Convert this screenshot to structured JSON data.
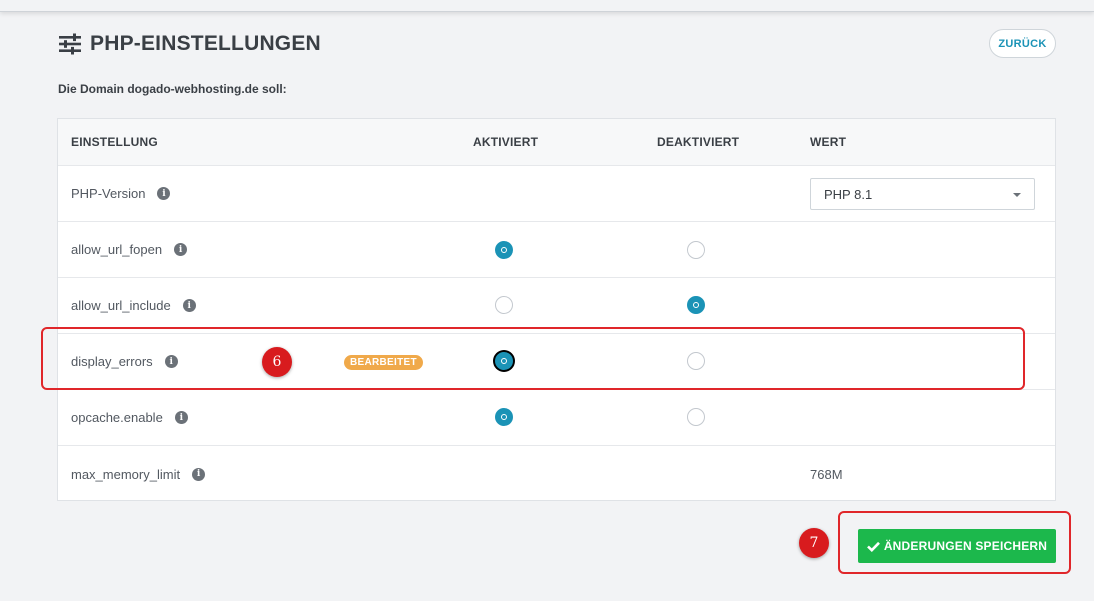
{
  "header": {
    "title": "PHP-EINSTELLUNGEN",
    "icon": "sliders-icon",
    "back_label": "ZURÜCK"
  },
  "domain_line": "Die Domain dogado-webhosting.de soll:",
  "table": {
    "headers": {
      "setting": "EINSTELLUNG",
      "enabled": "AKTIVIERT",
      "disabled": "DEAKTIVIERT",
      "value": "WERT"
    },
    "rows": [
      {
        "name": "PHP-Version",
        "value": "PHP 8.1"
      },
      {
        "name": "allow_url_fopen",
        "state": "aktiviert"
      },
      {
        "name": "allow_url_include",
        "state": "deaktiviert"
      },
      {
        "name": "display_errors",
        "state": "aktiviert",
        "badge": "BEARBEITET"
      },
      {
        "name": "opcache.enable",
        "state": "aktiviert"
      },
      {
        "name": "max_memory_limit",
        "value": "768M"
      }
    ]
  },
  "annotations": {
    "step6": "6",
    "step7": "7"
  },
  "save_label": "ÄNDERUNGEN SPEICHERN",
  "colors": {
    "accent": "#1b93b6",
    "save": "#1cb84c",
    "badge": "#f0a94a",
    "highlight": "#e0262a"
  }
}
